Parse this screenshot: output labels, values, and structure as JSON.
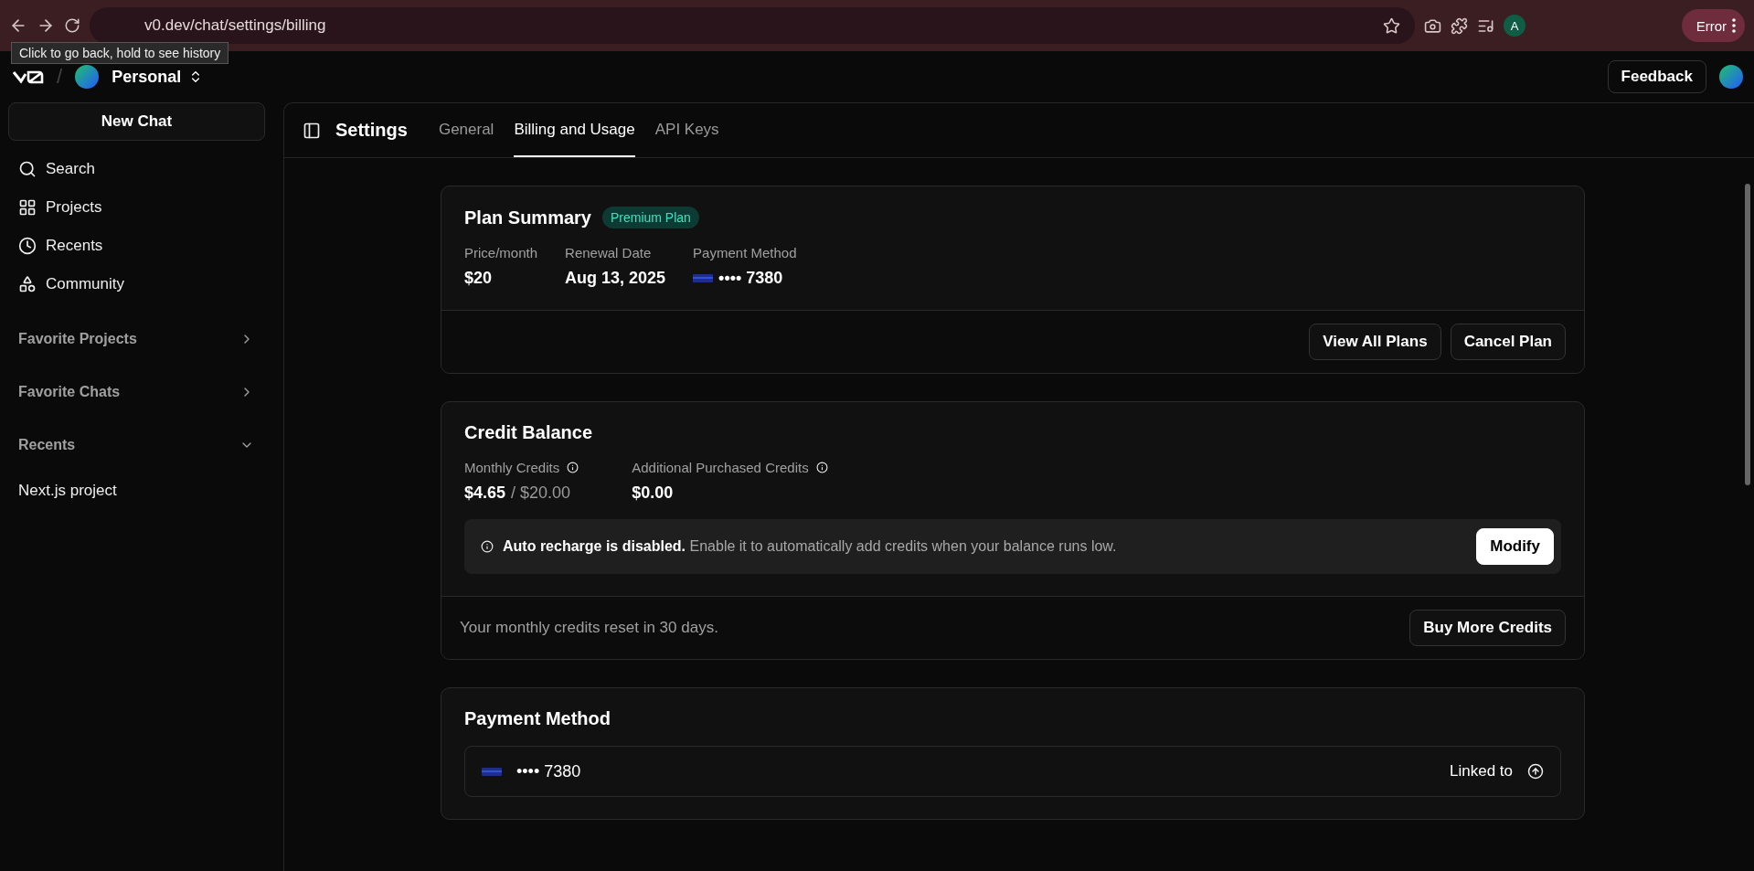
{
  "browser": {
    "url": "v0.dev/chat/settings/billing",
    "tooltip": "Click to go back, hold to see history",
    "profile_initial": "A",
    "error_label": "Error"
  },
  "header": {
    "separator": "/",
    "workspace": "Personal",
    "feedback": "Feedback"
  },
  "sidebar": {
    "new_chat": "New Chat",
    "nav": [
      {
        "label": "Search",
        "kind": "search"
      },
      {
        "label": "Projects",
        "kind": "grid"
      },
      {
        "label": "Recents",
        "kind": "clock"
      },
      {
        "label": "Community",
        "kind": "shapes"
      }
    ],
    "sections": [
      {
        "label": "Favorite Projects",
        "expanded": false
      },
      {
        "label": "Favorite Chats",
        "expanded": false
      },
      {
        "label": "Recents",
        "expanded": true,
        "children": [
          {
            "label": "Next.js project"
          }
        ]
      }
    ]
  },
  "settings": {
    "title": "Settings",
    "tabs": [
      {
        "label": "General",
        "selected": false
      },
      {
        "label": "Billing and Usage",
        "selected": true
      },
      {
        "label": "API Keys",
        "selected": false
      }
    ]
  },
  "plan": {
    "title": "Plan Summary",
    "badge": "Premium Plan",
    "fields": [
      {
        "label": "Price/month",
        "value": "$20",
        "kind": "text"
      },
      {
        "label": "Renewal Date",
        "value": "Aug 13, 2025",
        "kind": "text"
      },
      {
        "label": "Payment Method",
        "value": "•••• 7380",
        "kind": "card"
      }
    ],
    "buttons": [
      "View All Plans",
      "Cancel Plan"
    ]
  },
  "credit": {
    "title": "Credit Balance",
    "monthly": {
      "label": "Monthly Credits",
      "used": "$4.65",
      "total": "/ $20.00"
    },
    "additional": {
      "label": "Additional Purchased Credits",
      "value": "$0.00"
    },
    "notice": {
      "bold": "Auto recharge is disabled.",
      "text": "Enable it to automatically add credits when your balance runs low.",
      "button": "Modify"
    },
    "footer": {
      "text": "Your monthly credits reset in 30 days.",
      "button": "Buy More Credits"
    }
  },
  "payment": {
    "title": "Payment Method",
    "card": {
      "number": "•••• 7380",
      "linked": "Linked to"
    }
  }
}
